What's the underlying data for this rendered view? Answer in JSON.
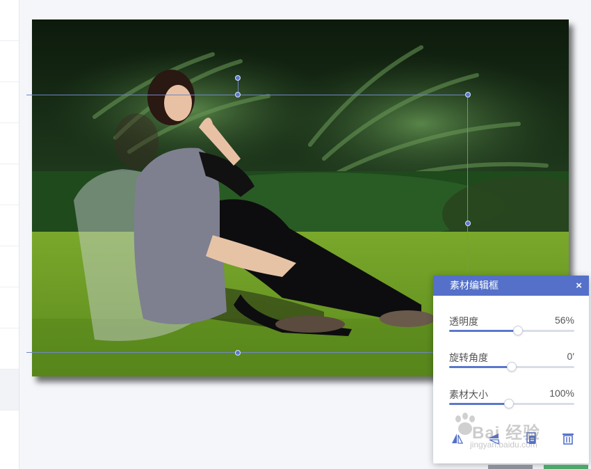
{
  "editor": {
    "title": "素材编辑框",
    "close_icon": "×",
    "sliders": [
      {
        "label": "透明度",
        "value_text": "56%",
        "level": 0.55
      },
      {
        "label": "旋转角度",
        "value_text": "0'",
        "level": 0.5
      },
      {
        "label": "素材大小",
        "value_text": "100%",
        "level": 0.48
      }
    ],
    "tools": [
      "flip-horizontal-icon",
      "flip-vertical-icon",
      "copy-layer-icon",
      "delete-icon"
    ]
  },
  "watermark": {
    "logo_text": "Bai 经验",
    "url": "jingyan.baidu.com"
  },
  "colors": {
    "accent": "#5470c9",
    "frame": "#6f87c9"
  }
}
